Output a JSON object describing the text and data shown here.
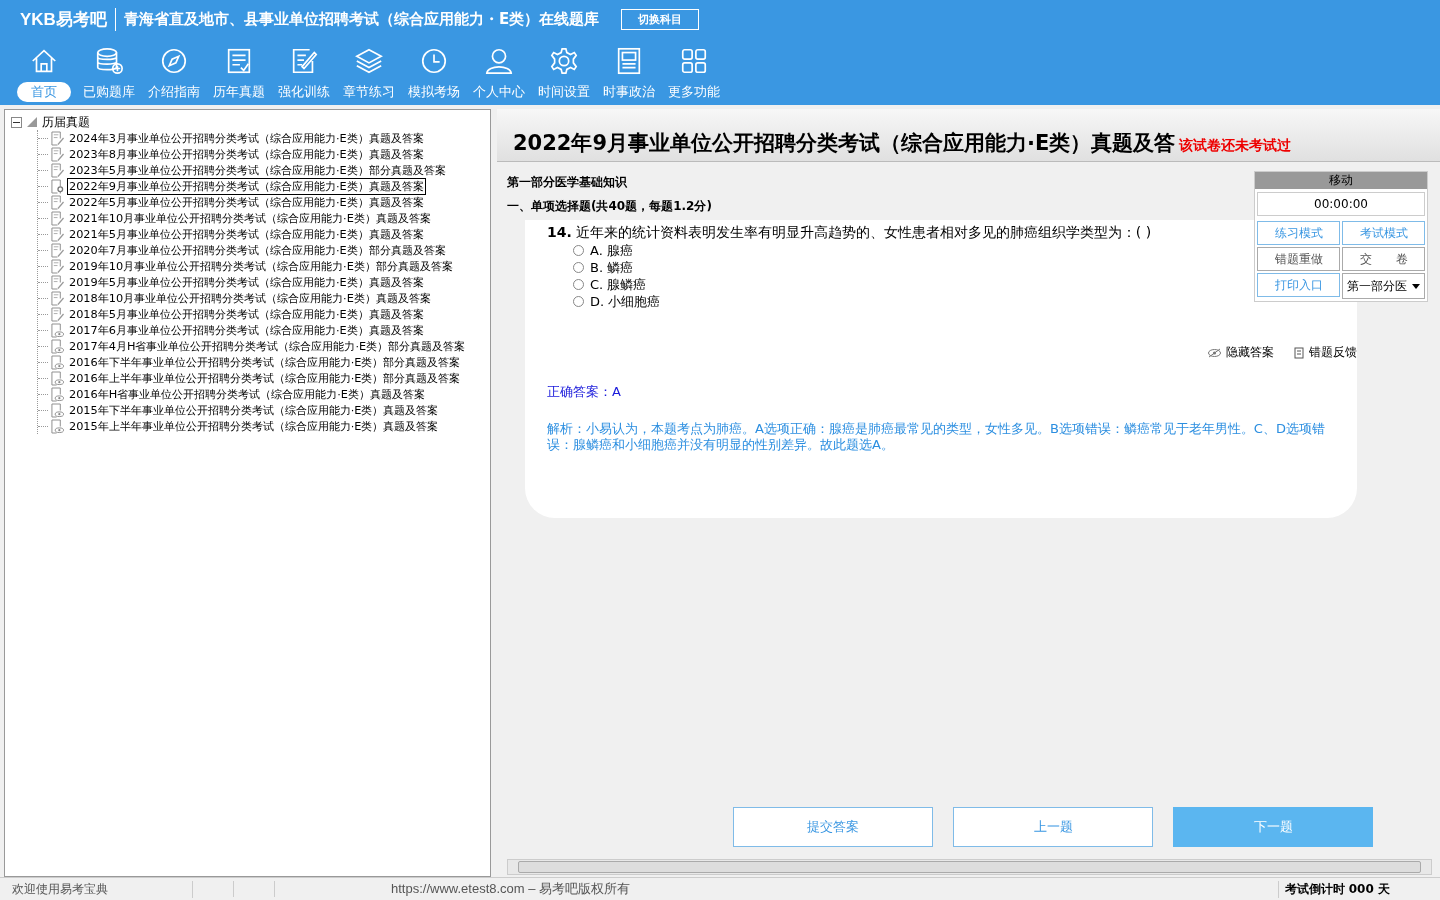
{
  "header": {
    "brand": "YKB易考吧",
    "title": "青海省直及地市、县事业单位招聘考试（综合应用能力・E类）在线题库",
    "switch_button": "切换科目"
  },
  "nav": [
    {
      "label": "首页",
      "selected": true
    },
    {
      "label": "已购题库",
      "selected": false
    },
    {
      "label": "介绍指南",
      "selected": false
    },
    {
      "label": "历年真题",
      "selected": false
    },
    {
      "label": "强化训练",
      "selected": false
    },
    {
      "label": "章节练习",
      "selected": false
    },
    {
      "label": "模拟考场",
      "selected": false
    },
    {
      "label": "个人中心",
      "selected": false
    },
    {
      "label": "时间设置",
      "selected": false
    },
    {
      "label": "时事政治",
      "selected": false
    },
    {
      "label": "更多功能",
      "selected": false
    }
  ],
  "tree": {
    "label": "历届真题",
    "expanded": true,
    "children": [
      {
        "label": "2024年3月事业单位公开招聘分类考试（综合应用能力·E类）真题及答案",
        "kind": "edit",
        "selected": false
      },
      {
        "label": "2023年8月事业单位公开招聘分类考试（综合应用能力·E类）真题及答案",
        "kind": "edit",
        "selected": false
      },
      {
        "label": "2023年5月事业单位公开招聘分类考试（综合应用能力·E类）部分真题及答案",
        "kind": "edit",
        "selected": false
      },
      {
        "label": "2022年9月事业单位公开招聘分类考试（综合应用能力·E类）真题及答案",
        "kind": "pin",
        "selected": true
      },
      {
        "label": "2022年5月事业单位公开招聘分类考试（综合应用能力·E类）真题及答案",
        "kind": "edit",
        "selected": false
      },
      {
        "label": "2021年10月事业单位公开招聘分类考试（综合应用能力·E类）真题及答案",
        "kind": "edit",
        "selected": false
      },
      {
        "label": "2021年5月事业单位公开招聘分类考试（综合应用能力·E类）真题及答案",
        "kind": "edit",
        "selected": false
      },
      {
        "label": "2020年7月事业单位公开招聘分类考试（综合应用能力·E类）部分真题及答案",
        "kind": "edit",
        "selected": false
      },
      {
        "label": "2019年10月事业单位公开招聘分类考试（综合应用能力·E类）部分真题及答案",
        "kind": "edit",
        "selected": false
      },
      {
        "label": "2019年5月事业单位公开招聘分类考试（综合应用能力·E类）真题及答案",
        "kind": "edit",
        "selected": false
      },
      {
        "label": "2018年10月事业单位公开招聘分类考试（综合应用能力·E类）真题及答案",
        "kind": "edit",
        "selected": false
      },
      {
        "label": "2018年5月事业单位公开招聘分类考试（综合应用能力·E类）真题及答案",
        "kind": "edit",
        "selected": false
      },
      {
        "label": "2017年6月事业单位公开招聘分类考试（综合应用能力·E类）真题及答案",
        "kind": "view",
        "selected": false
      },
      {
        "label": "2017年4月H省事业单位公开招聘分类考试（综合应用能力·E类）部分真题及答案",
        "kind": "view",
        "selected": false
      },
      {
        "label": "2016年下半年事业单位公开招聘分类考试（综合应用能力·E类）部分真题及答案",
        "kind": "view",
        "selected": false
      },
      {
        "label": "2016年上半年事业单位公开招聘分类考试（综合应用能力·E类）部分真题及答案",
        "kind": "view",
        "selected": false
      },
      {
        "label": "2016年H省事业单位公开招聘分类考试（综合应用能力·E类）真题及答案",
        "kind": "view",
        "selected": false
      },
      {
        "label": "2015年下半年事业单位公开招聘分类考试（综合应用能力·E类）真题及答案",
        "kind": "view",
        "selected": false
      },
      {
        "label": "2015年上半年事业单位公开招聘分类考试（综合应用能力·E类）真题及答案",
        "kind": "view",
        "selected": false
      }
    ]
  },
  "exam": {
    "title": "2022年9月事业单位公开招聘分类考试（综合应用能力·E类）真题及答",
    "notice": "该试卷还未考试过",
    "part": "第一部分医学基础知识",
    "section": "一、单项选择题(共40题，每题1.2分)",
    "question": {
      "number": "14.",
      "text": "近年来的统计资料表明发生率有明显升高趋势的、女性患者相对多见的肺癌组织学类型为：( )",
      "options": [
        {
          "label": "A. 腺癌",
          "selected": false
        },
        {
          "label": "B. 鳞癌",
          "selected": false
        },
        {
          "label": "C. 腺鳞癌",
          "selected": false
        },
        {
          "label": "D. 小细胞癌",
          "selected": false
        }
      ]
    },
    "hide_answer": "隐藏答案",
    "report_error": "错题反馈",
    "answer": "正确答案：A",
    "analysis": "解析：小易认为，本题考点为肺癌。A选项正确：腺癌是肺癌最常见的类型，女性多见。B选项错误：鳞癌常见于老年男性。C、D选项错误：腺鳞癌和小细胞癌并没有明显的性别差异。故此题选A。",
    "buttons": [
      {
        "label": "提交答案",
        "primary": false
      },
      {
        "label": "上一题",
        "primary": false
      },
      {
        "label": "下一题",
        "primary": true
      }
    ]
  },
  "float_panel": {
    "title": "移动",
    "timer": "00:00:00",
    "buttons": [
      {
        "label": "练习模式",
        "kind": "blue"
      },
      {
        "label": "考试模式",
        "kind": "blue"
      },
      {
        "label": "错题重做",
        "kind": "grey"
      },
      {
        "label": "交　　卷",
        "kind": "grey"
      },
      {
        "label": "打印入口",
        "kind": "blue"
      }
    ],
    "section_select": "第一部分医"
  },
  "status_bar": {
    "welcome": "欢迎使用易考宝典",
    "copyright": "https://www.etest8.com – 易考吧版权所有",
    "countdown": "考试倒计时 000 天"
  }
}
